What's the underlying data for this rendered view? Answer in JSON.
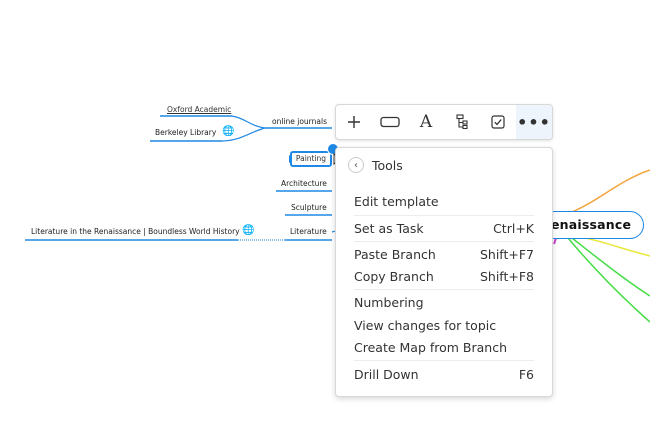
{
  "map": {
    "root": "Renaissance",
    "root_visible": "enaissance",
    "branches": {
      "online_journals": "online journals",
      "painting": "Painting",
      "architecture": "Architecture",
      "sculpture": "Sculpture",
      "literature": "Literature"
    },
    "links": {
      "oxford": "Oxford Academic",
      "berkeley": "Berkeley Library",
      "literature_link": "Literature in the Renaissance | Boundless World History"
    },
    "globe_icon": "globe-icon",
    "colors": {
      "accent": "#1e88e5",
      "orange": "#f4a23b",
      "yellow": "#e8e83a",
      "green": "#44dd44"
    }
  },
  "toolbar": {
    "buttons": [
      {
        "name": "add-topic",
        "icon": "+"
      },
      {
        "name": "shape",
        "icon": "▭"
      },
      {
        "name": "text-style",
        "icon": "A"
      },
      {
        "name": "structure",
        "icon": "structure-icon"
      },
      {
        "name": "task",
        "icon": "checkbox-icon"
      },
      {
        "name": "more",
        "icon": "•••"
      }
    ]
  },
  "menu": {
    "title": "Tools",
    "items": [
      {
        "label": "Edit template",
        "shortcut": ""
      },
      {
        "label": "Set as Task",
        "shortcut": "Ctrl+K"
      },
      {
        "label": "Paste Branch",
        "shortcut": "Shift+F7"
      },
      {
        "label": "Copy Branch",
        "shortcut": "Shift+F8"
      },
      {
        "label": "Numbering",
        "shortcut": ""
      },
      {
        "label": "View changes for topic",
        "shortcut": ""
      },
      {
        "label": "Create Map from Branch",
        "shortcut": ""
      },
      {
        "label": "Drill Down",
        "shortcut": "F6"
      }
    ]
  }
}
